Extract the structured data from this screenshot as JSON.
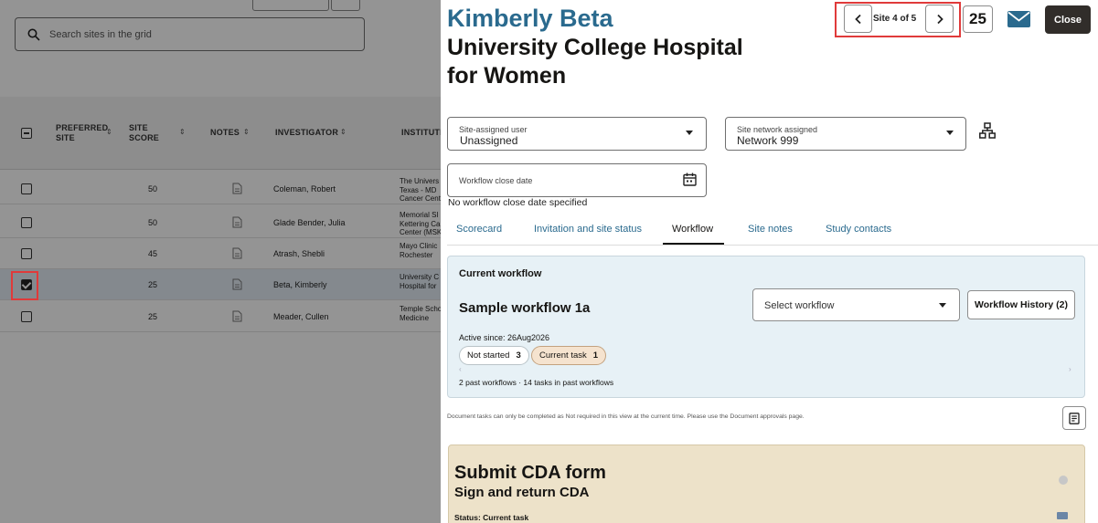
{
  "grid": {
    "search_placeholder": "Search sites in the grid",
    "columns": {
      "preferred_site": "PREFERRED SITE",
      "site_score": "SITE SCORE",
      "notes": "NOTES",
      "investigator": "INVESTIGATOR",
      "institution": "INSTITUTI"
    },
    "rows": [
      {
        "score": "50",
        "investigator": "Coleman, Robert",
        "institution": "The Univers\nTexas - MD\nCancer Cent",
        "selected": false
      },
      {
        "score": "50",
        "investigator": "Glade Bender, Julia",
        "institution": "Memorial Sl\nKettering Ca\nCenter (MSK",
        "selected": false
      },
      {
        "score": "45",
        "investigator": "Atrash, Shebli",
        "institution": "Mayo Clinic\nRochester",
        "selected": false
      },
      {
        "score": "25",
        "investigator": "Beta, Kimberly",
        "institution": "University C\nHospital for",
        "selected": true
      },
      {
        "score": "25",
        "investigator": "Meader, Cullen",
        "institution": "Temple Scho\nMedicine",
        "selected": false
      }
    ]
  },
  "drawer": {
    "investigator_name": "Kimberly Beta",
    "site_name": "University College Hospital for Women",
    "pager_text": "Site 4 of 5",
    "score": "25",
    "close_label": "Close",
    "site_user_label": "Site-assigned user",
    "site_user_value": "Unassigned",
    "site_network_label": "Site network assigned",
    "site_network_value": "Network 999",
    "close_date_label": "Workflow close date",
    "no_close_date": "No workflow close date specified",
    "tabs": [
      "Scorecard",
      "Invitation and site status",
      "Workflow",
      "Site notes",
      "Study contacts"
    ],
    "active_tab": "Workflow",
    "workflow": {
      "heading": "Current workflow",
      "name": "Sample workflow 1a",
      "select_placeholder": "Select workflow",
      "history_label": "Workflow History (2)",
      "active_since": "Active since: 26Aug2026",
      "chip_not_started_label": "Not started",
      "chip_not_started_count": "3",
      "chip_current_label": "Current task",
      "chip_current_count": "1",
      "past_summary": "2 past workflows · 14 tasks in past workflows"
    },
    "doc_note": "Document tasks can only be completed as Not required in this view at the current time. Please use the Document approvals page.",
    "task": {
      "title": "Submit CDA form",
      "subtitle": "Sign and return CDA",
      "status": "Status: Current task"
    }
  }
}
